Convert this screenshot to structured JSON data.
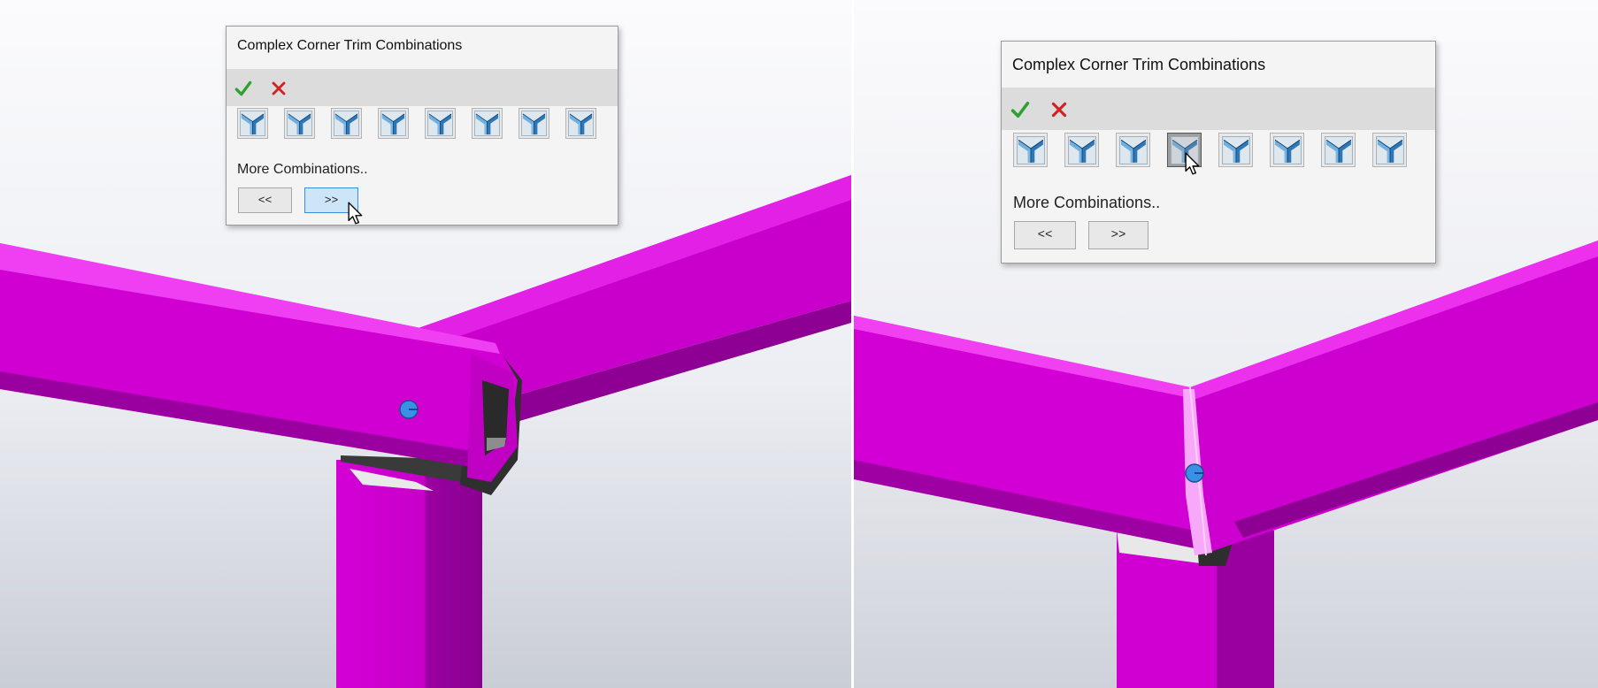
{
  "left_view": {
    "dialog": {
      "title": "Complex Corner Trim Combinations",
      "ok_icon": "green-checkmark",
      "cancel_icon": "red-x",
      "combination_icons": [
        "corner-trim-combo-1",
        "corner-trim-combo-2",
        "corner-trim-combo-3",
        "corner-trim-combo-4",
        "corner-trim-combo-5",
        "corner-trim-combo-6",
        "corner-trim-combo-7",
        "corner-trim-combo-8"
      ],
      "more_label": "More Combinations..",
      "prev_label": "<<",
      "next_label": ">>",
      "hovered": "next"
    }
  },
  "right_view": {
    "dialog": {
      "title": "Complex Corner Trim Combinations",
      "ok_icon": "green-checkmark",
      "cancel_icon": "red-x",
      "combination_icons": [
        "corner-trim-combo-1",
        "corner-trim-combo-2",
        "corner-trim-combo-3",
        "corner-trim-combo-4",
        "corner-trim-combo-5",
        "corner-trim-combo-6",
        "corner-trim-combo-7",
        "corner-trim-combo-8"
      ],
      "more_label": "More Combinations..",
      "prev_label": "<<",
      "next_label": ">>",
      "selected_index": 3
    }
  },
  "colors": {
    "tube": "#d600d8",
    "tube_light": "#ee3cf0",
    "tube_dark": "#8f0094",
    "steel": "#4a4a4a",
    "viewport_top": "#fbfbfd",
    "viewport_bottom": "#c9cdd6",
    "accent_blue": "#3c8fd6",
    "ok_green": "#2fa02f",
    "cancel_red": "#d02020"
  }
}
